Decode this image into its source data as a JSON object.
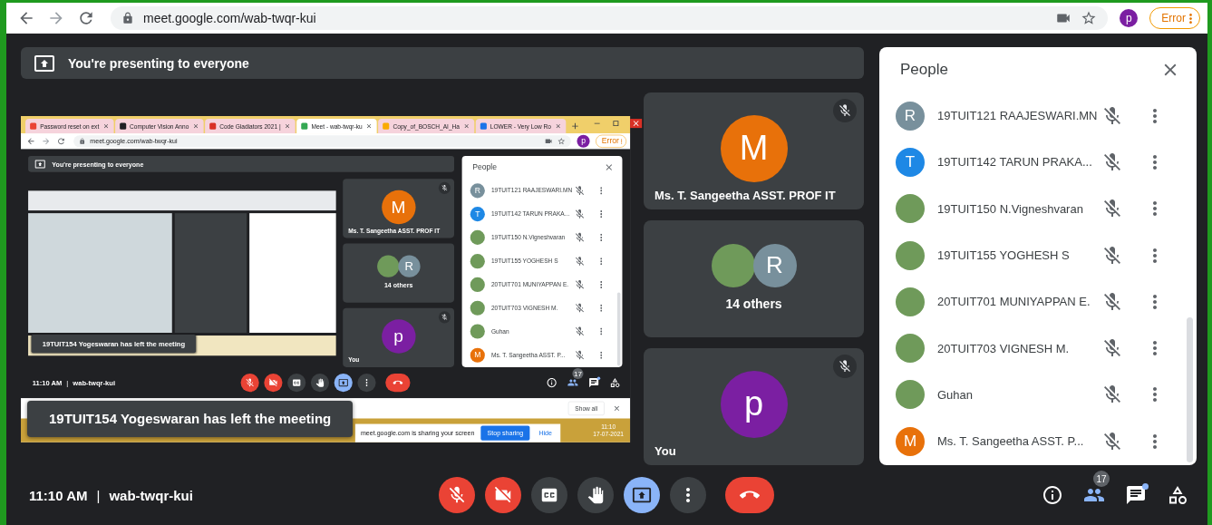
{
  "browser": {
    "url": "meet.google.com/wab-twqr-kui",
    "profile_initial": "p",
    "error_label": "Error"
  },
  "meeting": {
    "presenting_banner": "You're presenting to everyone",
    "shared_screen": {
      "kind": "browser",
      "tabs": [
        {
          "label": "Password reset on ext",
          "selected": false
        },
        {
          "label": "Computer Vision Anno",
          "selected": false
        },
        {
          "label": "Code Gladiators 2021 |",
          "selected": false
        },
        {
          "label": "Meet - wab-twqr-ku",
          "selected": true
        },
        {
          "label": "Copy_of_BOSCH_AI_Ha",
          "selected": false
        },
        {
          "label": "LOWER - Very Low Ro",
          "selected": false
        }
      ],
      "browser": {
        "url": "meet.google.com/wab-twqr-kui",
        "profile_initial": "p",
        "error_label": "Error"
      },
      "meeting": {
        "presenting_banner": "You're presenting to everyone",
        "shared_screen": {
          "kind": "placeholder"
        },
        "tiles": [
          {
            "kind": "single",
            "initial": "M",
            "color": "#e8710a",
            "name": "Ms. T. Sangeetha ASST. PROF IT",
            "muted": true
          },
          {
            "kind": "group",
            "label": "14 others",
            "initial": "R",
            "color": "#78909c",
            "muted": false
          },
          {
            "kind": "single",
            "initial": "p",
            "color": "#7b1fa2",
            "name": "You",
            "muted": true
          }
        ],
        "toast": "19TUIT154 Yogeswaran has left the meeting",
        "people": {
          "title": "People",
          "participants": [
            {
              "name": "19TUIT121 RAAJESWARI.MN",
              "kind": "initial",
              "initial": "R",
              "color": "#78909c",
              "muted": true
            },
            {
              "name": "19TUIT142 TARUN PRAKA...",
              "kind": "initial",
              "initial": "T",
              "color": "#1e88e5",
              "muted": true
            },
            {
              "name": "19TUIT150 N.Vigneshvaran",
              "kind": "photo",
              "muted": true
            },
            {
              "name": "19TUIT155 YOGHESH S",
              "kind": "photo",
              "muted": true
            },
            {
              "name": "20TUIT701 MUNIYAPPAN E.",
              "kind": "photo",
              "muted": true
            },
            {
              "name": "20TUIT703 VIGNESH M.",
              "kind": "photo",
              "muted": true
            },
            {
              "name": "Guhan",
              "kind": "photo",
              "muted": true
            },
            {
              "name": "Ms. T. Sangeetha ASST. P...",
              "kind": "initial",
              "initial": "M",
              "color": "#e8710a",
              "muted": true
            }
          ]
        },
        "time": "11:10 AM",
        "separator": "|",
        "meeting_code": "wab-twqr-kui",
        "controls": [
          {
            "kind": "mic",
            "on": false
          },
          {
            "kind": "camera",
            "on": false
          },
          {
            "kind": "captions",
            "on": false
          },
          {
            "kind": "hand",
            "on": false
          },
          {
            "kind": "present",
            "on": true
          },
          {
            "kind": "more"
          },
          {
            "kind": "leave"
          }
        ],
        "participant_count": "17",
        "chat_unread": true
      },
      "download_bar": {
        "button": "Show all"
      },
      "share_notice": {
        "message": "meet.google.com is sharing your screen",
        "stop_button": "Stop sharing",
        "hide_button": "Hide"
      },
      "clock": {
        "time": "11:10",
        "date": "17-07-2021"
      }
    },
    "tiles": [
      {
        "kind": "single",
        "initial": "M",
        "color": "#e8710a",
        "name": "Ms. T. Sangeetha ASST. PROF IT",
        "muted": true
      },
      {
        "kind": "group",
        "label": "14 others",
        "initial": "R",
        "color": "#78909c",
        "muted": false
      },
      {
        "kind": "single",
        "initial": "p",
        "color": "#7b1fa2",
        "name": "You",
        "muted": true
      }
    ],
    "toast": "19TUIT154 Yogeswaran has left the meeting",
    "people": {
      "title": "People",
      "participants": [
        {
          "name": "19TUIT121 RAAJESWARI.MN",
          "kind": "initial",
          "initial": "R",
          "color": "#78909c",
          "muted": true
        },
        {
          "name": "19TUIT142 TARUN PRAKA...",
          "kind": "initial",
          "initial": "T",
          "color": "#1e88e5",
          "muted": true
        },
        {
          "name": "19TUIT150 N.Vigneshvaran",
          "kind": "photo",
          "muted": true
        },
        {
          "name": "19TUIT155 YOGHESH S",
          "kind": "photo",
          "muted": true
        },
        {
          "name": "20TUIT701 MUNIYAPPAN E.",
          "kind": "photo",
          "muted": true
        },
        {
          "name": "20TUIT703 VIGNESH M.",
          "kind": "photo",
          "muted": true
        },
        {
          "name": "Guhan",
          "kind": "photo",
          "muted": true
        },
        {
          "name": "Ms. T. Sangeetha ASST. P...",
          "kind": "initial",
          "initial": "M",
          "color": "#e8710a",
          "muted": true
        }
      ]
    },
    "time": "11:10 AM",
    "separator": "|",
    "meeting_code": "wab-twqr-kui",
    "controls": [
      {
        "kind": "mic",
        "on": false
      },
      {
        "kind": "camera",
        "on": false
      },
      {
        "kind": "captions",
        "on": false
      },
      {
        "kind": "hand",
        "on": false
      },
      {
        "kind": "present",
        "on": true
      },
      {
        "kind": "more"
      },
      {
        "kind": "leave"
      }
    ],
    "participant_count": "17",
    "chat_unread": true
  }
}
